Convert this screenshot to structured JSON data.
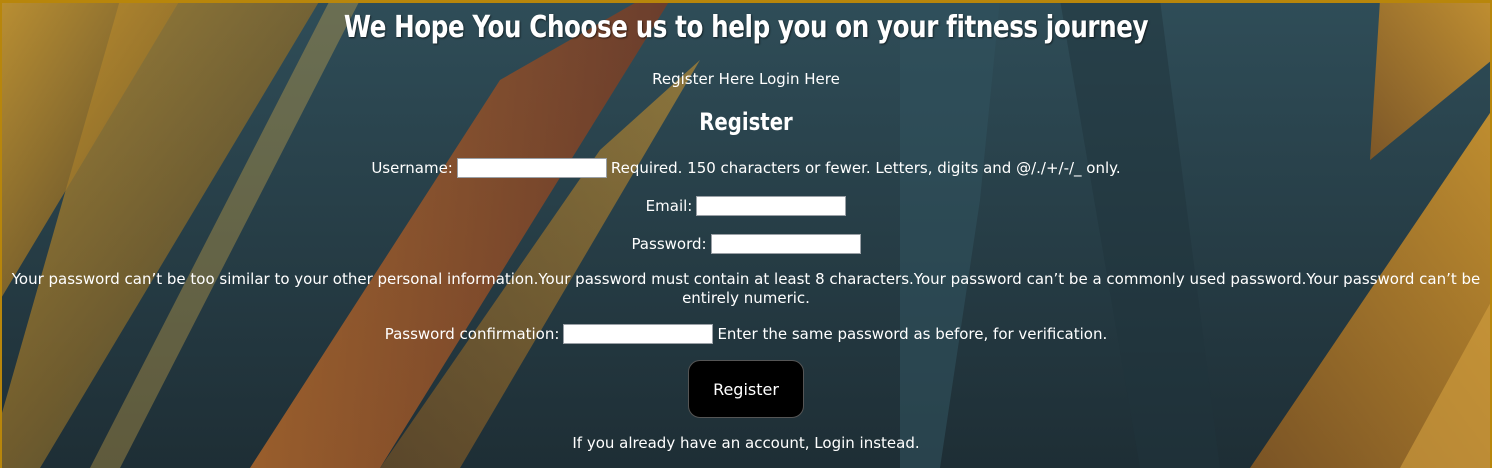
{
  "header": {
    "title": "We Hope You Choose us to help you on your fitness journey"
  },
  "nav": {
    "register_link": "Register Here",
    "login_link": "Login Here"
  },
  "form": {
    "heading": "Register",
    "username_label": "Username:",
    "username_value": "",
    "username_help": "Required. 150 characters or fewer. Letters, digits and @/./+/-/_ only.",
    "email_label": "Email:",
    "email_value": "",
    "password_label": "Password:",
    "password_value": "",
    "password_help": "Your password can’t be too similar to your other personal information.Your password must contain at least 8 characters.Your password can’t be a commonly used password.Your password can’t be entirely numeric.",
    "confirm_label": "Password confirmation:",
    "confirm_value": "",
    "confirm_help": "Enter the same password as before, for verification.",
    "submit_label": "Register"
  },
  "footer": {
    "prefix": "If you already have an account, ",
    "login_link": "Login instead."
  },
  "colors": {
    "background": "#243b45",
    "accent": "#b8860b",
    "button": "#000000"
  }
}
